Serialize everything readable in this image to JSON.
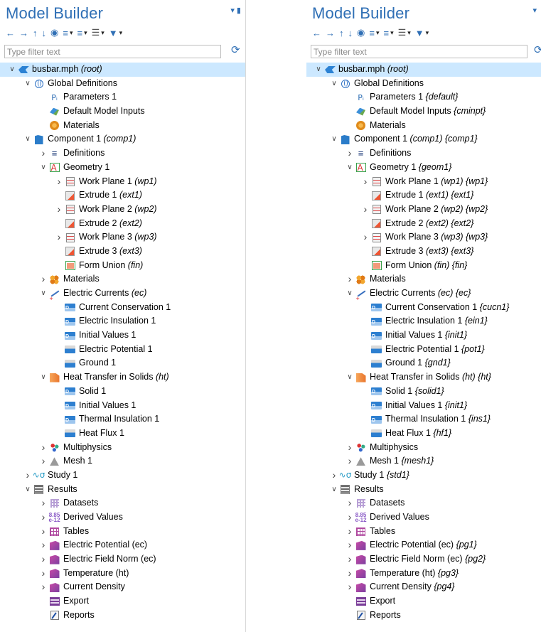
{
  "panels": [
    {
      "id": "left",
      "title": "Model Builder",
      "filter_placeholder": "Type filter text",
      "rows": [
        {
          "indent": 0,
          "chev": "v",
          "icon": "root-icon",
          "icls": "i-root",
          "label": "busbar.mph",
          "tag": "(root)",
          "sel": true
        },
        {
          "indent": 1,
          "chev": "v",
          "icon": "globe-icon",
          "icls": "i-globe",
          "label": "Global Definitions",
          "tag": ""
        },
        {
          "indent": 2,
          "chev": "",
          "icon": "parameters-icon",
          "icls": "i-pi",
          "glyph": "Pᵢ",
          "label": "Parameters 1",
          "tag": ""
        },
        {
          "indent": 2,
          "chev": "",
          "icon": "model-inputs-icon",
          "icls": "i-inputs",
          "label": "Default Model Inputs",
          "tag": ""
        },
        {
          "indent": 2,
          "chev": "",
          "icon": "materials-icon",
          "icls": "i-mat",
          "label": "Materials",
          "tag": ""
        },
        {
          "indent": 1,
          "chev": "v",
          "icon": "component-icon",
          "icls": "i-comp",
          "label": "Component 1",
          "tag": "(comp1)"
        },
        {
          "indent": 2,
          "chev": ">",
          "icon": "definitions-icon",
          "icls": "i-defs",
          "glyph": "≡",
          "label": "Definitions",
          "tag": ""
        },
        {
          "indent": 2,
          "chev": "v",
          "icon": "geometry-icon",
          "icls": "i-geom",
          "label": "Geometry 1",
          "tag": ""
        },
        {
          "indent": 3,
          "chev": ">",
          "icon": "work-plane-icon",
          "icls": "i-wp",
          "label": "Work Plane 1",
          "tag": "(wp1)"
        },
        {
          "indent": 3,
          "chev": "",
          "icon": "extrude-icon",
          "icls": "i-ext",
          "label": "Extrude 1",
          "tag": "(ext1)"
        },
        {
          "indent": 3,
          "chev": ">",
          "icon": "work-plane-icon",
          "icls": "i-wp",
          "label": "Work Plane 2",
          "tag": "(wp2)"
        },
        {
          "indent": 3,
          "chev": "",
          "icon": "extrude-icon",
          "icls": "i-ext",
          "label": "Extrude 2",
          "tag": "(ext2)"
        },
        {
          "indent": 3,
          "chev": ">",
          "icon": "work-plane-icon",
          "icls": "i-wp",
          "label": "Work Plane 3",
          "tag": "(wp3)"
        },
        {
          "indent": 3,
          "chev": "",
          "icon": "extrude-icon",
          "icls": "i-ext",
          "label": "Extrude 3",
          "tag": "(ext3)"
        },
        {
          "indent": 3,
          "chev": "",
          "icon": "form-union-icon",
          "icls": "i-fin",
          "label": "Form Union",
          "tag": "(fin)"
        },
        {
          "indent": 2,
          "chev": ">",
          "icon": "materials-icon",
          "icls": "i-mats",
          "label": "Materials",
          "tag": ""
        },
        {
          "indent": 2,
          "chev": "v",
          "icon": "electric-currents-icon",
          "icls": "i-ec",
          "label": "Electric Currents",
          "tag": "(ec)"
        },
        {
          "indent": 3,
          "chev": "",
          "icon": "domain-node-icon",
          "icls": "i-node",
          "label": "Current Conservation 1",
          "tag": ""
        },
        {
          "indent": 3,
          "chev": "",
          "icon": "domain-node-icon",
          "icls": "i-node",
          "label": "Electric Insulation 1",
          "tag": ""
        },
        {
          "indent": 3,
          "chev": "",
          "icon": "domain-node-icon",
          "icls": "i-node",
          "label": "Initial Values 1",
          "tag": ""
        },
        {
          "indent": 3,
          "chev": "",
          "icon": "boundary-node-icon",
          "icls": "i-bnode",
          "label": "Electric Potential 1",
          "tag": ""
        },
        {
          "indent": 3,
          "chev": "",
          "icon": "boundary-node-icon",
          "icls": "i-bnode",
          "label": "Ground 1",
          "tag": ""
        },
        {
          "indent": 2,
          "chev": "v",
          "icon": "heat-transfer-icon",
          "icls": "i-ht",
          "label": "Heat Transfer in Solids",
          "tag": "(ht)"
        },
        {
          "indent": 3,
          "chev": "",
          "icon": "domain-node-icon",
          "icls": "i-node",
          "label": "Solid 1",
          "tag": ""
        },
        {
          "indent": 3,
          "chev": "",
          "icon": "domain-node-icon",
          "icls": "i-node",
          "label": "Initial Values 1",
          "tag": ""
        },
        {
          "indent": 3,
          "chev": "",
          "icon": "domain-node-icon",
          "icls": "i-node",
          "label": "Thermal Insulation 1",
          "tag": ""
        },
        {
          "indent": 3,
          "chev": "",
          "icon": "boundary-node-icon",
          "icls": "i-bnode",
          "label": "Heat Flux 1",
          "tag": ""
        },
        {
          "indent": 2,
          "chev": ">",
          "icon": "multiphysics-icon",
          "icls": "i-multi",
          "label": "Multiphysics",
          "tag": ""
        },
        {
          "indent": 2,
          "chev": ">",
          "icon": "mesh-icon",
          "icls": "i-mesh",
          "label": "Mesh 1",
          "tag": ""
        },
        {
          "indent": 1,
          "chev": ">",
          "icon": "study-icon",
          "icls": "i-study",
          "glyph": "∿σ",
          "label": "Study 1",
          "tag": ""
        },
        {
          "indent": 1,
          "chev": "v",
          "icon": "results-icon",
          "icls": "i-results",
          "label": "Results",
          "tag": ""
        },
        {
          "indent": 2,
          "chev": ">",
          "icon": "datasets-icon",
          "icls": "i-dataset",
          "label": "Datasets",
          "tag": ""
        },
        {
          "indent": 2,
          "chev": ">",
          "icon": "derived-values-icon",
          "icls": "i-derived",
          "glyph": "8.85\ne-12",
          "label": "Derived Values",
          "tag": ""
        },
        {
          "indent": 2,
          "chev": ">",
          "icon": "tables-icon",
          "icls": "i-table",
          "label": "Tables",
          "tag": ""
        },
        {
          "indent": 2,
          "chev": ">",
          "icon": "plot-group-icon",
          "icls": "i-plot",
          "label": "Electric Potential (ec)",
          "tag": ""
        },
        {
          "indent": 2,
          "chev": ">",
          "icon": "plot-group-icon",
          "icls": "i-plot",
          "label": "Electric Field Norm (ec)",
          "tag": ""
        },
        {
          "indent": 2,
          "chev": ">",
          "icon": "plot-group-icon",
          "icls": "i-plot",
          "label": "Temperature (ht)",
          "tag": ""
        },
        {
          "indent": 2,
          "chev": ">",
          "icon": "plot-group-icon",
          "icls": "i-plot",
          "label": "Current Density",
          "tag": ""
        },
        {
          "indent": 2,
          "chev": "",
          "icon": "export-icon",
          "icls": "i-export",
          "label": "Export",
          "tag": ""
        },
        {
          "indent": 2,
          "chev": "",
          "icon": "reports-icon",
          "icls": "i-report",
          "label": "Reports",
          "tag": ""
        }
      ]
    },
    {
      "id": "right",
      "title": "Model Builder",
      "filter_placeholder": "Type filter text",
      "rows": [
        {
          "indent": 0,
          "chev": "v",
          "icon": "root-icon",
          "icls": "i-root",
          "label": "busbar.mph",
          "tag": "(root)",
          "sel": true
        },
        {
          "indent": 1,
          "chev": "v",
          "icon": "globe-icon",
          "icls": "i-globe",
          "label": "Global Definitions",
          "tag": ""
        },
        {
          "indent": 2,
          "chev": "",
          "icon": "parameters-icon",
          "icls": "i-pi",
          "glyph": "Pᵢ",
          "label": "Parameters 1",
          "tag": "{default}"
        },
        {
          "indent": 2,
          "chev": "",
          "icon": "model-inputs-icon",
          "icls": "i-inputs",
          "label": "Default Model Inputs",
          "tag": "{cminpt}"
        },
        {
          "indent": 2,
          "chev": "",
          "icon": "materials-icon",
          "icls": "i-mat",
          "label": "Materials",
          "tag": ""
        },
        {
          "indent": 1,
          "chev": "v",
          "icon": "component-icon",
          "icls": "i-comp",
          "label": "Component 1",
          "tag": "(comp1) {comp1}"
        },
        {
          "indent": 2,
          "chev": ">",
          "icon": "definitions-icon",
          "icls": "i-defs",
          "glyph": "≡",
          "label": "Definitions",
          "tag": ""
        },
        {
          "indent": 2,
          "chev": "v",
          "icon": "geometry-icon",
          "icls": "i-geom",
          "label": "Geometry 1",
          "tag": "{geom1}"
        },
        {
          "indent": 3,
          "chev": ">",
          "icon": "work-plane-icon",
          "icls": "i-wp",
          "label": "Work Plane 1",
          "tag": "(wp1) {wp1}"
        },
        {
          "indent": 3,
          "chev": "",
          "icon": "extrude-icon",
          "icls": "i-ext",
          "label": "Extrude 1",
          "tag": "(ext1) {ext1}"
        },
        {
          "indent": 3,
          "chev": ">",
          "icon": "work-plane-icon",
          "icls": "i-wp",
          "label": "Work Plane 2",
          "tag": "(wp2) {wp2}"
        },
        {
          "indent": 3,
          "chev": "",
          "icon": "extrude-icon",
          "icls": "i-ext",
          "label": "Extrude 2",
          "tag": "(ext2) {ext2}"
        },
        {
          "indent": 3,
          "chev": ">",
          "icon": "work-plane-icon",
          "icls": "i-wp",
          "label": "Work Plane 3",
          "tag": "(wp3) {wp3}"
        },
        {
          "indent": 3,
          "chev": "",
          "icon": "extrude-icon",
          "icls": "i-ext",
          "label": "Extrude 3",
          "tag": "(ext3) {ext3}"
        },
        {
          "indent": 3,
          "chev": "",
          "icon": "form-union-icon",
          "icls": "i-fin",
          "label": "Form Union",
          "tag": "(fin) {fin}"
        },
        {
          "indent": 2,
          "chev": ">",
          "icon": "materials-icon",
          "icls": "i-mats",
          "label": "Materials",
          "tag": ""
        },
        {
          "indent": 2,
          "chev": "v",
          "icon": "electric-currents-icon",
          "icls": "i-ec",
          "label": "Electric Currents",
          "tag": "(ec) {ec}"
        },
        {
          "indent": 3,
          "chev": "",
          "icon": "domain-node-icon",
          "icls": "i-node",
          "label": "Current Conservation 1",
          "tag": "{cucn1}"
        },
        {
          "indent": 3,
          "chev": "",
          "icon": "domain-node-icon",
          "icls": "i-node",
          "label": "Electric Insulation 1",
          "tag": "{ein1}"
        },
        {
          "indent": 3,
          "chev": "",
          "icon": "domain-node-icon",
          "icls": "i-node",
          "label": "Initial Values 1",
          "tag": "{init1}"
        },
        {
          "indent": 3,
          "chev": "",
          "icon": "boundary-node-icon",
          "icls": "i-bnode",
          "label": "Electric Potential 1",
          "tag": "{pot1}"
        },
        {
          "indent": 3,
          "chev": "",
          "icon": "boundary-node-icon",
          "icls": "i-bnode",
          "label": "Ground 1",
          "tag": "{gnd1}"
        },
        {
          "indent": 2,
          "chev": "v",
          "icon": "heat-transfer-icon",
          "icls": "i-ht",
          "label": "Heat Transfer in Solids",
          "tag": "(ht) {ht}"
        },
        {
          "indent": 3,
          "chev": "",
          "icon": "domain-node-icon",
          "icls": "i-node",
          "label": "Solid 1",
          "tag": "{solid1}"
        },
        {
          "indent": 3,
          "chev": "",
          "icon": "domain-node-icon",
          "icls": "i-node",
          "label": "Initial Values 1",
          "tag": "{init1}"
        },
        {
          "indent": 3,
          "chev": "",
          "icon": "domain-node-icon",
          "icls": "i-node",
          "label": "Thermal Insulation 1",
          "tag": "{ins1}"
        },
        {
          "indent": 3,
          "chev": "",
          "icon": "boundary-node-icon",
          "icls": "i-bnode",
          "label": "Heat Flux 1",
          "tag": "{hf1}"
        },
        {
          "indent": 2,
          "chev": ">",
          "icon": "multiphysics-icon",
          "icls": "i-multi",
          "label": "Multiphysics",
          "tag": ""
        },
        {
          "indent": 2,
          "chev": ">",
          "icon": "mesh-icon",
          "icls": "i-mesh",
          "label": "Mesh 1",
          "tag": "{mesh1}"
        },
        {
          "indent": 1,
          "chev": ">",
          "icon": "study-icon",
          "icls": "i-study",
          "glyph": "∿σ",
          "label": "Study 1",
          "tag": "{std1}"
        },
        {
          "indent": 1,
          "chev": "v",
          "icon": "results-icon",
          "icls": "i-results",
          "label": "Results",
          "tag": ""
        },
        {
          "indent": 2,
          "chev": ">",
          "icon": "datasets-icon",
          "icls": "i-dataset",
          "label": "Datasets",
          "tag": ""
        },
        {
          "indent": 2,
          "chev": ">",
          "icon": "derived-values-icon",
          "icls": "i-derived",
          "glyph": "8.85\ne-12",
          "label": "Derived Values",
          "tag": ""
        },
        {
          "indent": 2,
          "chev": ">",
          "icon": "tables-icon",
          "icls": "i-table",
          "label": "Tables",
          "tag": ""
        },
        {
          "indent": 2,
          "chev": ">",
          "icon": "plot-group-icon",
          "icls": "i-plot",
          "label": "Electric Potential (ec)",
          "tag": "{pg1}"
        },
        {
          "indent": 2,
          "chev": ">",
          "icon": "plot-group-icon",
          "icls": "i-plot",
          "label": "Electric Field Norm (ec)",
          "tag": "{pg2}"
        },
        {
          "indent": 2,
          "chev": ">",
          "icon": "plot-group-icon",
          "icls": "i-plot",
          "label": "Temperature (ht)",
          "tag": "{pg3}"
        },
        {
          "indent": 2,
          "chev": ">",
          "icon": "plot-group-icon",
          "icls": "i-plot",
          "label": "Current Density",
          "tag": "{pg4}"
        },
        {
          "indent": 2,
          "chev": "",
          "icon": "export-icon",
          "icls": "i-export",
          "label": "Export",
          "tag": ""
        },
        {
          "indent": 2,
          "chev": "",
          "icon": "reports-icon",
          "icls": "i-report",
          "label": "Reports",
          "tag": ""
        }
      ]
    }
  ],
  "toolbar_icons": [
    "arrow-left-icon",
    "arrow-right-icon",
    "arrow-up-icon",
    "arrow-down-icon",
    "show-icon",
    "expand-sort-icon",
    "collapse-sort-icon",
    "view-options-icon",
    "filter-icon"
  ],
  "colors": {
    "title": "#2f6fb5",
    "selection": "#cce8ff"
  }
}
